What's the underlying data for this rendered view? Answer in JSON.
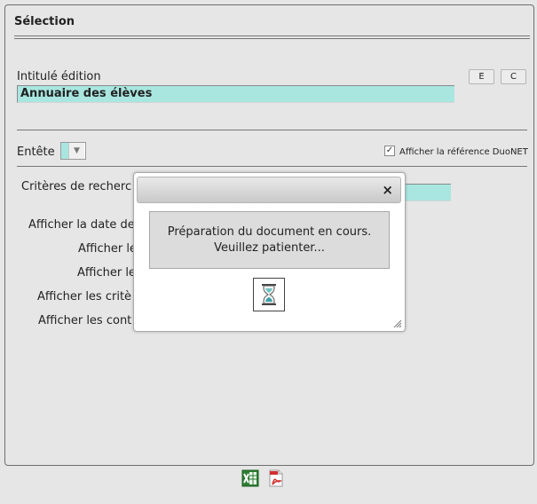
{
  "section": {
    "title": "Sélection"
  },
  "edition": {
    "label": "Intitulé édition",
    "value": "Annuaire des élèves",
    "btn_e": "E",
    "btn_c": "C"
  },
  "entete": {
    "label": "Entête"
  },
  "duonet": {
    "label": "Afficher la référence DuoNET",
    "checked": true
  },
  "criteria": {
    "label": "Critères de recherc"
  },
  "options": [
    {
      "label": "Afficher la date de"
    },
    {
      "label": "Afficher le"
    },
    {
      "label": "Afficher le"
    },
    {
      "label": "Afficher les critè"
    },
    {
      "label": "Afficher les cont"
    }
  ],
  "dialog": {
    "close": "×",
    "line1": "Préparation du document en cours.",
    "line2": "Veuillez patienter..."
  },
  "footer": {
    "excel_icon": "excel-icon",
    "pdf_icon": "pdf-icon"
  },
  "colors": {
    "accent": "#a9e6e0",
    "panel": "#e6e6e6"
  }
}
